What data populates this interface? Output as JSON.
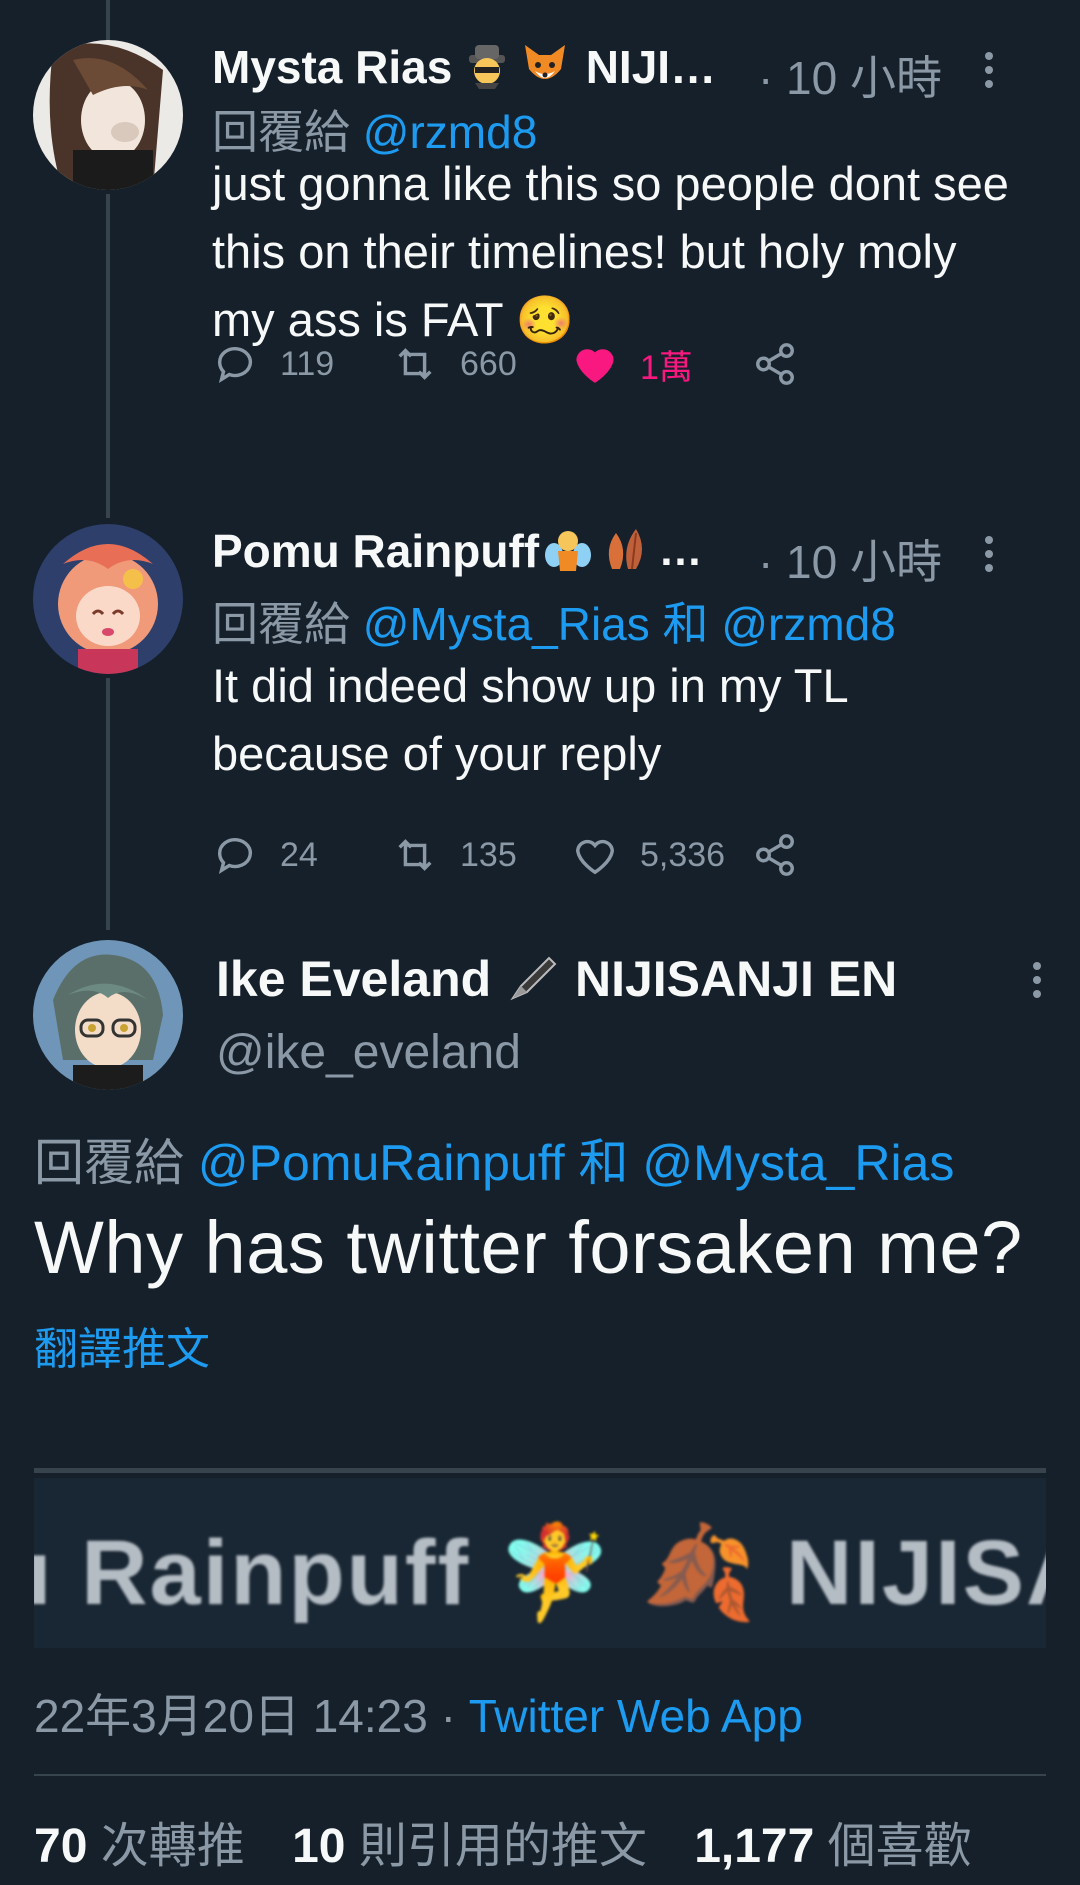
{
  "replies": [
    {
      "name": "Mysta Rias",
      "name_truncated": "NIJI…",
      "time": "· 10 小時",
      "reply_prefix": "回覆給",
      "reply_mentions": "@rzmd8",
      "reply_joiner": "",
      "reply_mentions2": "",
      "text": "just gonna like this so people dont see this on their timelines! but holy moly my ass is FAT 🥴",
      "replies_count": "119",
      "retweets_count": "660",
      "likes_count": "1萬",
      "liked": true,
      "avatar_colors": [
        "#e8e6e3",
        "#3b2a22"
      ]
    },
    {
      "name": "Pomu Rainpuff",
      "name_truncated": "…",
      "time": "· 10 小時",
      "reply_prefix": "回覆給",
      "reply_mentions": "@Mysta_Rias",
      "reply_joiner": "和",
      "reply_mentions2": "@rzmd8",
      "text": "It did indeed show up in my TL because of your reply",
      "replies_count": "24",
      "retweets_count": "135",
      "likes_count": "5,336",
      "liked": false,
      "avatar_colors": [
        "#3a4e7a",
        "#f2a08a"
      ]
    }
  ],
  "main": {
    "name": "Ike Eveland",
    "name_suffix": "NIJISANJI EN",
    "handle": "@ike_eveland",
    "reply_prefix": "回覆給",
    "reply_mention1": "@PomuRainpuff",
    "reply_joiner": "和",
    "reply_mention2": "@Mysta_Rias",
    "text": "Why has twitter forsaken me?",
    "translate_label": "翻譯推文",
    "embedded_text": "ı Rainpuff 🧚 🍂 NIJISANJI",
    "timestamp": "22年3月20日 14:23 ·",
    "source": "Twitter Web App",
    "retweets_num": "70",
    "retweets_label": "次轉推",
    "quotes_num": "10",
    "quotes_label": "則引用的推文",
    "likes_num": "1,177",
    "likes_label": "個喜歡"
  },
  "colors": {
    "background": "#15202b",
    "accent": "#1d9bf0",
    "secondary_text": "#8b98a5",
    "like_pink": "#f91880"
  },
  "icons": [
    "reply-icon",
    "retweet-icon",
    "like-icon",
    "share-icon",
    "more-options-icon"
  ]
}
